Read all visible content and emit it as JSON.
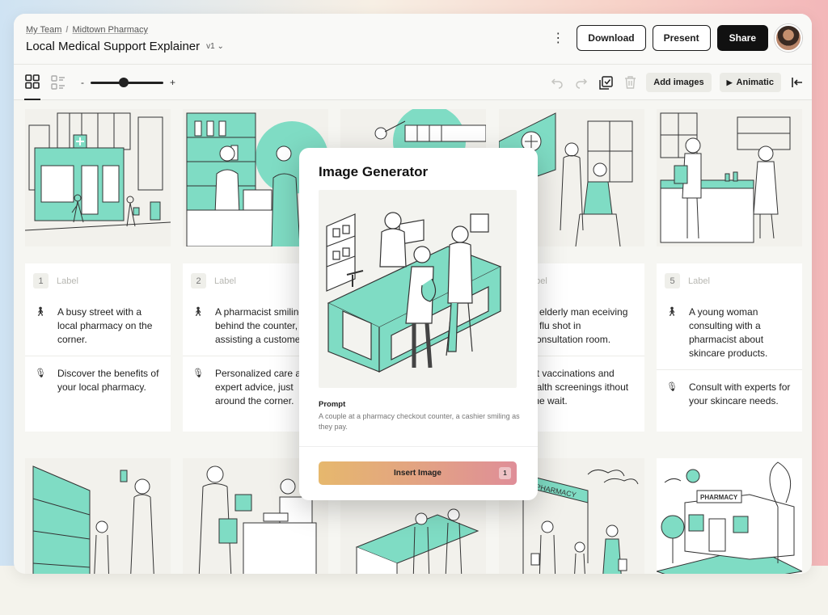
{
  "breadcrumb": {
    "team": "My Team",
    "project": "Midtown Pharmacy"
  },
  "document": {
    "title": "Local Medical Support Explainer",
    "version": "v1"
  },
  "header_actions": {
    "download": "Download",
    "present": "Present",
    "share": "Share"
  },
  "toolbar": {
    "zoom_minus": "-",
    "zoom_plus": "+",
    "zoom_level": 0.45,
    "add_images": "Add images",
    "animatic": "Animatic"
  },
  "colors": {
    "accent": "#7fdcc4",
    "primary": "#111111",
    "insert_gradient_start": "#e6b86d",
    "insert_gradient_end": "#df8e98"
  },
  "scenes": [
    {
      "number": "1",
      "label": "Label",
      "action": "A busy street with a local pharmacy on the corner.",
      "voiceover": "Discover the benefits of your local pharmacy."
    },
    {
      "number": "2",
      "label": "Label",
      "action": "A pharmacist smiling behind the counter, assisting a custome",
      "voiceover": "Personalized care a expert advice, just around the corner."
    },
    {
      "number": "",
      "label": "",
      "action": "",
      "voiceover": ""
    },
    {
      "number": "",
      "label": "abel",
      "action": "n elderly man eceiving a flu shot in consultation room.",
      "voiceover": "et vaccinations and ealth screenings ithout the wait."
    },
    {
      "number": "5",
      "label": "Label",
      "action": "A young woman consulting with a pharmacist about skincare products.",
      "voiceover": "Consult with experts for your skincare needs."
    }
  ],
  "modal": {
    "title": "Image Generator",
    "prompt_label": "Prompt",
    "prompt_text": "A couple at a pharmacy checkout counter, a cashier smiling as they pay.",
    "insert_label": "Insert Image",
    "insert_count": "1"
  },
  "bottom_row_labels": {
    "store_sign_1": "PHARMACY",
    "store_sign_2": "PHARMACY"
  }
}
